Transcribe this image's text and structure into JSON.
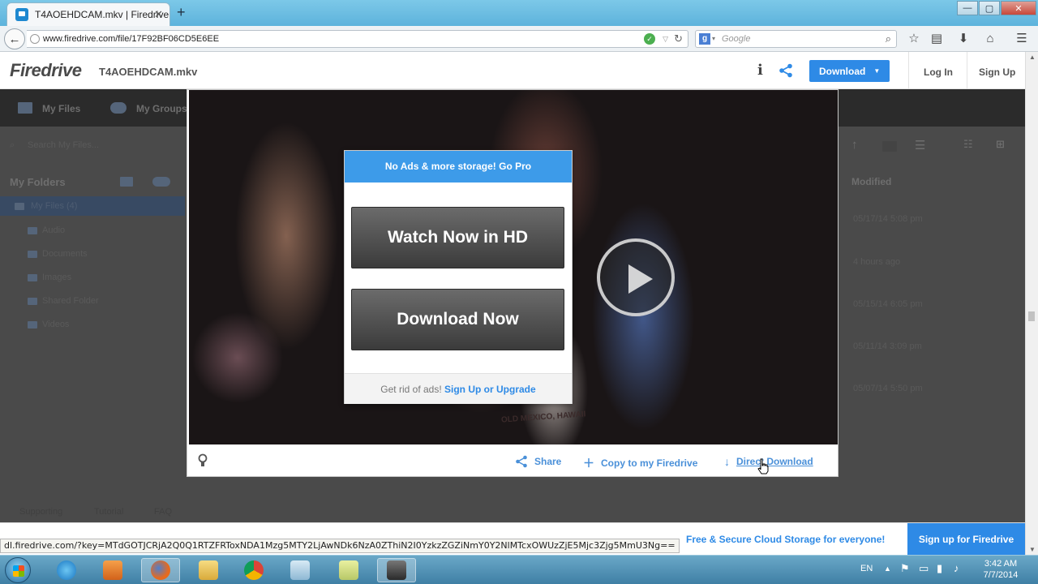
{
  "browser": {
    "tab_title": "T4AOEHDCAM.mkv | Firedrive",
    "url": "www.firedrive.com/file/17F92BF06CD5E6EE",
    "search_engine": "Google",
    "search_placeholder": "Google",
    "status_url": "dl.firedrive.com/?key=MTdGOTJCRjA2Q0Q1RTZFRToxNDA1Mzg5MTY2LjAwNDk6NzA0ZThiN2I0YzkzZGZiNmY0Y2NlMTcxOWUzZjE5Mjc3Zjg5MmU3Ng=="
  },
  "header": {
    "logo": "Firedrive",
    "filename": "T4AOEHDCAM.mkv",
    "info": "i",
    "download_label": "Download",
    "login_label": "Log In",
    "signup_label": "Sign Up"
  },
  "background": {
    "nav": [
      "My Files",
      "My Groups"
    ],
    "search_placeholder": "Search My Files...",
    "folders_title": "My Folders",
    "folders": [
      "My Files (4)",
      "Audio",
      "Documents",
      "Images",
      "Shared Folder",
      "Videos"
    ],
    "modified_header": "Modified",
    "modified_values": [
      "05/17/14 5:08 pm",
      "4 hours ago",
      "05/15/14 6:05 pm",
      "05/11/14 3:09 pm",
      "05/07/14 5:50 pm"
    ],
    "footer_items": [
      "Supporting",
      "Tutorial",
      "FAQ"
    ]
  },
  "popup": {
    "header": "No Ads & more storage! Go Pro",
    "watch_label": "Watch Now in HD",
    "download_label": "Download Now",
    "footer_text": "Get rid of ads!",
    "footer_link": "Sign Up or Upgrade"
  },
  "video": {
    "shirt_text": "OLD MEXICO, HAWAII"
  },
  "actions": {
    "share": "Share",
    "copy": "Copy to my Firedrive",
    "direct": "Direct Download"
  },
  "promo": {
    "text": "Free & Secure Cloud Storage for everyone!",
    "button": "Sign up for Firedrive"
  },
  "taskbar": {
    "language": "EN",
    "time": "3:42 AM",
    "date": "7/7/2014"
  },
  "colors": {
    "accent": "#2e8ae6",
    "popup_header": "#3d9be9",
    "big_button": "#4a4a4a"
  }
}
